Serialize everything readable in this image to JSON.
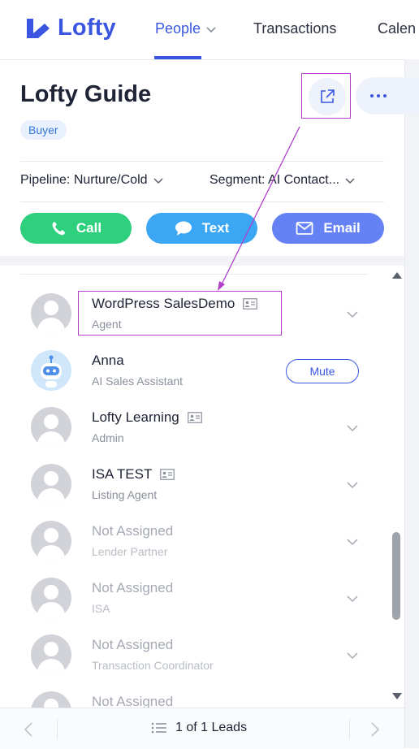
{
  "brand": {
    "name": "Lofty",
    "color": "#3a56e0"
  },
  "nav": {
    "people": "People",
    "transactions": "Transactions",
    "calendar": "Calen"
  },
  "header": {
    "title": "Lofty Guide",
    "badge": "Buyer",
    "pipeline": "Pipeline: Nurture/Cold",
    "segment": "Segment: AI Contact..."
  },
  "actions": {
    "call": "Call",
    "text": "Text",
    "email": "Email"
  },
  "team": [
    {
      "name": "WordPress SalesDemo",
      "role": "Agent",
      "card": true,
      "muted": false,
      "robot": false
    },
    {
      "name": "Anna",
      "role": "AI Sales Assistant",
      "card": false,
      "muted": false,
      "robot": true,
      "button": "Mute"
    },
    {
      "name": "Lofty Learning",
      "role": "Admin",
      "card": true,
      "muted": false,
      "robot": false
    },
    {
      "name": "ISA TEST",
      "role": "Listing Agent",
      "card": true,
      "muted": false,
      "robot": false
    },
    {
      "name": "Not Assigned",
      "role": "Lender Partner",
      "card": false,
      "muted": true,
      "robot": false
    },
    {
      "name": "Not Assigned",
      "role": "ISA",
      "card": false,
      "muted": true,
      "robot": false
    },
    {
      "name": "Not Assigned",
      "role": "Transaction Coordinator",
      "card": false,
      "muted": true,
      "robot": false
    },
    {
      "name": "Not Assigned",
      "role": "",
      "card": false,
      "muted": true,
      "robot": false
    }
  ],
  "footer": {
    "leads": "1 of 1 Leads"
  },
  "colors": {
    "call": "#2ecf7d",
    "text": "#3aa6f4",
    "email": "#6582f5",
    "annotation": "#b23ec9"
  }
}
